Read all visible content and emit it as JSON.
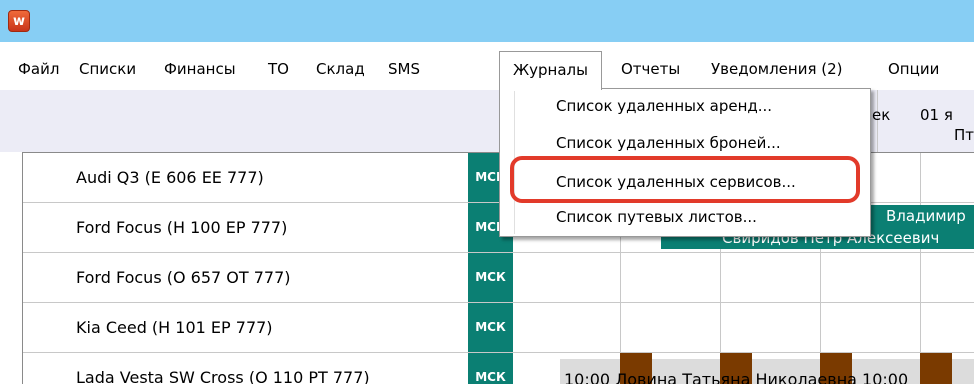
{
  "menubar": {
    "items": [
      "Файл",
      "Списки",
      "Финансы",
      "ТО",
      "Склад",
      "SMS",
      "Журналы",
      "Отчеты",
      "Уведомления (2)",
      "Опции"
    ]
  },
  "titlebar": {
    "icon_letter": "w"
  },
  "header": {
    "col1_partial": "ек",
    "col2_date": "01 я",
    "col2_day": "Пт"
  },
  "dropdown": {
    "items": [
      "Список удаленных аренд...",
      "Список удаленных броней...",
      "Список удаленных сервисов...",
      "Список путевых листов..."
    ]
  },
  "rows": [
    {
      "car": "Audi Q3 (Е 606 ЕЕ 777)",
      "badge": "МСК"
    },
    {
      "car": "Ford Focus (Н 100 ЕР 777)",
      "badge": "МСК"
    },
    {
      "car": "Ford Focus (О 657 ОТ 777)",
      "badge": "МСК"
    },
    {
      "car": "Kia Ceed (Н 101 ЕР 777)",
      "badge": "МСК"
    },
    {
      "car": "Lada Vesta SW Cross (О 110 РТ 777)",
      "badge": "МСК"
    }
  ],
  "bookings": {
    "row2_top": "Владимир",
    "row2_bottom": "Свиридов Петр Алексеевич",
    "row5": "10:00 Ловина Татьяна Николаевна 10:00"
  },
  "colors": {
    "accent": "#0b7f73",
    "titlebar": "#87cef4",
    "highlight": "#e23a2a",
    "brown": "#7a3a00"
  }
}
